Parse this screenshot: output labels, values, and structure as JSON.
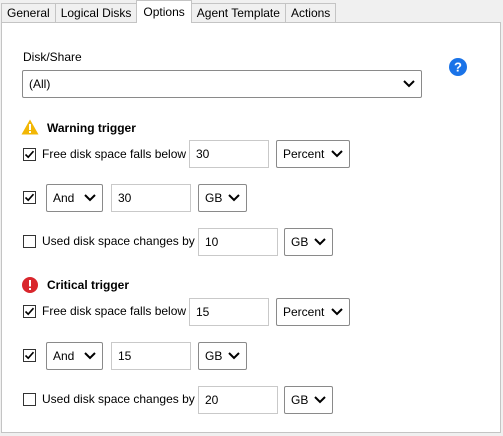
{
  "tabs": [
    {
      "label": "General"
    },
    {
      "label": "Logical Disks"
    },
    {
      "label": "Options"
    },
    {
      "label": "Agent Template"
    },
    {
      "label": "Actions"
    }
  ],
  "active_tab": "Options",
  "disk_share": {
    "label": "Disk/Share",
    "selected": "(All)"
  },
  "help_icon": "help-icon",
  "warning": {
    "title": "Warning trigger",
    "icon": "warning-icon",
    "free_space": {
      "checked": true,
      "label": "Free disk space falls below",
      "value": "30",
      "unit": "Percent"
    },
    "and_row": {
      "checked": true,
      "operator": "And",
      "value": "30",
      "unit": "GB"
    },
    "used_space": {
      "checked": false,
      "label": "Used disk space changes by",
      "value": "10",
      "unit": "GB"
    }
  },
  "critical": {
    "title": "Critical trigger",
    "icon": "critical-icon",
    "free_space": {
      "checked": true,
      "label": "Free disk space falls below",
      "value": "15",
      "unit": "Percent"
    },
    "and_row": {
      "checked": true,
      "operator": "And",
      "value": "15",
      "unit": "GB"
    },
    "used_space": {
      "checked": false,
      "label": "Used disk space changes by",
      "value": "20",
      "unit": "GB"
    }
  },
  "colors": {
    "help": "#1a73e8",
    "warning": "#f2b705",
    "critical": "#d9262c"
  }
}
